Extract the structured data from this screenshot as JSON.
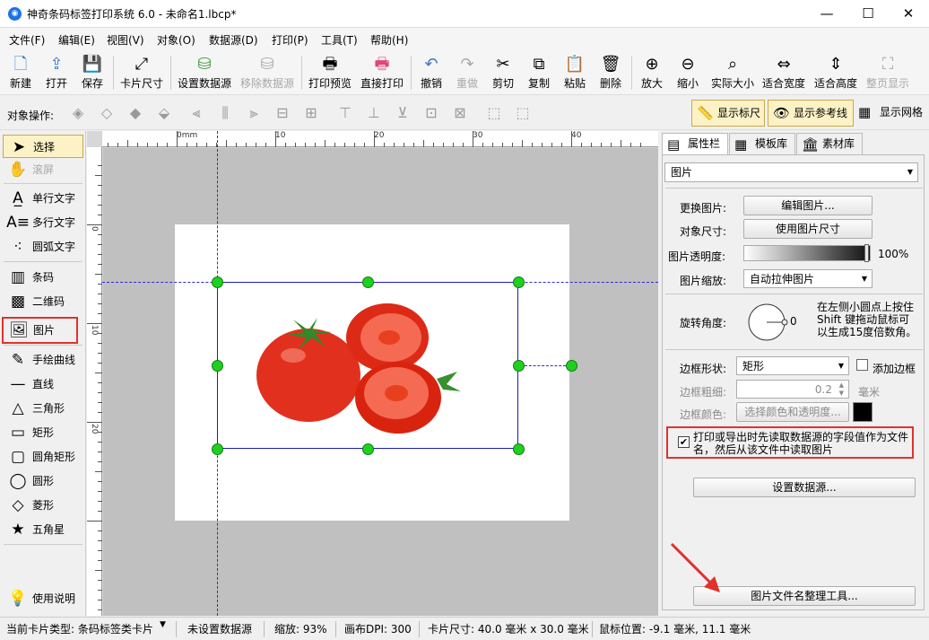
{
  "window": {
    "title": "神奇条码标签打印系统 6.0 - 未命名1.lbcp*",
    "app_icon": "app-logo-icon"
  },
  "menu": [
    "文件(F)",
    "编辑(E)",
    "视图(V)",
    "对象(O)",
    "数据源(D)",
    "打印(P)",
    "工具(T)",
    "帮助(H)"
  ],
  "toolbar": {
    "new": "新建",
    "open": "打开",
    "save": "保存",
    "card_size": "卡片尺寸",
    "set_datasource": "设置数据源",
    "remove_datasource": "移除数据源",
    "print_preview": "打印预览",
    "direct_print": "直接打印",
    "undo": "撤销",
    "redo": "重做",
    "cut": "剪切",
    "copy": "复制",
    "paste": "粘贴",
    "delete": "删除",
    "zoom_in": "放大",
    "zoom_out": "缩小",
    "actual_size": "实际大小",
    "fit_width": "适合宽度",
    "fit_height": "适合高度",
    "fit_page": "整页显示"
  },
  "object_bar": {
    "label": "对象操作:",
    "show_ruler": "显示标尺",
    "show_guides": "显示参考线",
    "show_grid": "显示网格"
  },
  "tools": {
    "select": "选择",
    "scroll": "滚屏",
    "single_text": "单行文字",
    "multi_text": "多行文字",
    "arc_text": "圆弧文字",
    "barcode": "条码",
    "qrcode": "二维码",
    "image": "图片",
    "freehand": "手绘曲线",
    "line": "直线",
    "triangle": "三角形",
    "rectangle": "矩形",
    "rounded_rect": "圆角矩形",
    "circle": "圆形",
    "diamond": "菱形",
    "star": "五角星",
    "help": "使用说明"
  },
  "ruler": {
    "top": [
      "0mm",
      "10",
      "20",
      "30",
      "40"
    ],
    "left": [
      "0",
      "10",
      "20"
    ]
  },
  "panel": {
    "tabs": [
      "属性栏",
      "模板库",
      "素材库"
    ],
    "object_type": "图片",
    "change_image_label": "更换图片:",
    "edit_image_button": "编辑图片...",
    "object_size_label": "对象尺寸:",
    "use_image_size_button": "使用图片尺寸",
    "opacity_label": "图片透明度:",
    "opacity_value": "100%",
    "opacity_fraction": 1.0,
    "scale_label": "图片缩放:",
    "scale_value": "自动拉伸图片",
    "rotation_label": "旋转角度:",
    "rotation_value": "0",
    "rotation_hint": "在左侧小圆点上按住 Shift 键拖动鼠标可以生成15度倍数角。",
    "border_shape_label": "边框形状:",
    "border_shape_value": "矩形",
    "add_border_label": "添加边框",
    "border_width_label": "边框粗细:",
    "border_width_value": "0.2",
    "border_width_unit": "毫米",
    "border_color_label": "边框颜色:",
    "border_color_button": "选择颜色和透明度...",
    "border_color": "#000000",
    "read_filename_checkbox": "打印或导出时先读取数据源的字段值作为文件名，然后从该文件中读取图片",
    "read_filename_checked": true,
    "set_datasource_button": "设置数据源...",
    "filename_tool_button": "图片文件名整理工具..."
  },
  "status": {
    "card_type": "当前卡片类型: 条码标签类卡片",
    "datasource": "未设置数据源",
    "zoom": "缩放: 93%",
    "dpi": "画布DPI: 300",
    "card_size": "卡片尺寸: 40.0 毫米 x 30.0 毫米",
    "mouse_pos": "鼠标位置: -9.1 毫米, 11.1 毫米"
  },
  "colors": {
    "accent": "#fdf2c6",
    "highlight": "#e0322c",
    "handle": "#1fd11f",
    "guide": "#2a2ad6"
  }
}
